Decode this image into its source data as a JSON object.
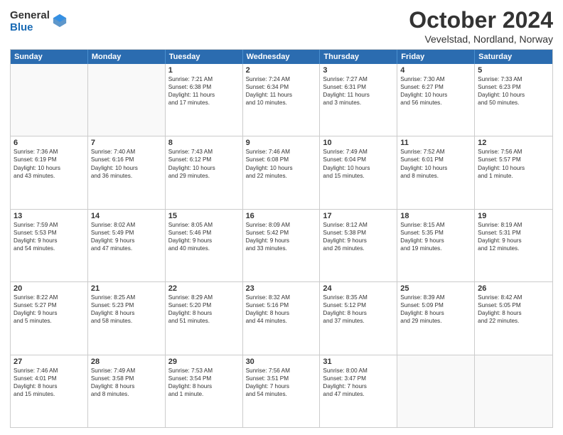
{
  "header": {
    "logo_general": "General",
    "logo_blue": "Blue",
    "title": "October 2024",
    "subtitle": "Vevelstad, Nordland, Norway"
  },
  "days_of_week": [
    "Sunday",
    "Monday",
    "Tuesday",
    "Wednesday",
    "Thursday",
    "Friday",
    "Saturday"
  ],
  "weeks": [
    [
      {
        "day": "",
        "info": ""
      },
      {
        "day": "",
        "info": ""
      },
      {
        "day": "1",
        "info": "Sunrise: 7:21 AM\nSunset: 6:38 PM\nDaylight: 11 hours\nand 17 minutes."
      },
      {
        "day": "2",
        "info": "Sunrise: 7:24 AM\nSunset: 6:34 PM\nDaylight: 11 hours\nand 10 minutes."
      },
      {
        "day": "3",
        "info": "Sunrise: 7:27 AM\nSunset: 6:31 PM\nDaylight: 11 hours\nand 3 minutes."
      },
      {
        "day": "4",
        "info": "Sunrise: 7:30 AM\nSunset: 6:27 PM\nDaylight: 10 hours\nand 56 minutes."
      },
      {
        "day": "5",
        "info": "Sunrise: 7:33 AM\nSunset: 6:23 PM\nDaylight: 10 hours\nand 50 minutes."
      }
    ],
    [
      {
        "day": "6",
        "info": "Sunrise: 7:36 AM\nSunset: 6:19 PM\nDaylight: 10 hours\nand 43 minutes."
      },
      {
        "day": "7",
        "info": "Sunrise: 7:40 AM\nSunset: 6:16 PM\nDaylight: 10 hours\nand 36 minutes."
      },
      {
        "day": "8",
        "info": "Sunrise: 7:43 AM\nSunset: 6:12 PM\nDaylight: 10 hours\nand 29 minutes."
      },
      {
        "day": "9",
        "info": "Sunrise: 7:46 AM\nSunset: 6:08 PM\nDaylight: 10 hours\nand 22 minutes."
      },
      {
        "day": "10",
        "info": "Sunrise: 7:49 AM\nSunset: 6:04 PM\nDaylight: 10 hours\nand 15 minutes."
      },
      {
        "day": "11",
        "info": "Sunrise: 7:52 AM\nSunset: 6:01 PM\nDaylight: 10 hours\nand 8 minutes."
      },
      {
        "day": "12",
        "info": "Sunrise: 7:56 AM\nSunset: 5:57 PM\nDaylight: 10 hours\nand 1 minute."
      }
    ],
    [
      {
        "day": "13",
        "info": "Sunrise: 7:59 AM\nSunset: 5:53 PM\nDaylight: 9 hours\nand 54 minutes."
      },
      {
        "day": "14",
        "info": "Sunrise: 8:02 AM\nSunset: 5:49 PM\nDaylight: 9 hours\nand 47 minutes."
      },
      {
        "day": "15",
        "info": "Sunrise: 8:05 AM\nSunset: 5:46 PM\nDaylight: 9 hours\nand 40 minutes."
      },
      {
        "day": "16",
        "info": "Sunrise: 8:09 AM\nSunset: 5:42 PM\nDaylight: 9 hours\nand 33 minutes."
      },
      {
        "day": "17",
        "info": "Sunrise: 8:12 AM\nSunset: 5:38 PM\nDaylight: 9 hours\nand 26 minutes."
      },
      {
        "day": "18",
        "info": "Sunrise: 8:15 AM\nSunset: 5:35 PM\nDaylight: 9 hours\nand 19 minutes."
      },
      {
        "day": "19",
        "info": "Sunrise: 8:19 AM\nSunset: 5:31 PM\nDaylight: 9 hours\nand 12 minutes."
      }
    ],
    [
      {
        "day": "20",
        "info": "Sunrise: 8:22 AM\nSunset: 5:27 PM\nDaylight: 9 hours\nand 5 minutes."
      },
      {
        "day": "21",
        "info": "Sunrise: 8:25 AM\nSunset: 5:23 PM\nDaylight: 8 hours\nand 58 minutes."
      },
      {
        "day": "22",
        "info": "Sunrise: 8:29 AM\nSunset: 5:20 PM\nDaylight: 8 hours\nand 51 minutes."
      },
      {
        "day": "23",
        "info": "Sunrise: 8:32 AM\nSunset: 5:16 PM\nDaylight: 8 hours\nand 44 minutes."
      },
      {
        "day": "24",
        "info": "Sunrise: 8:35 AM\nSunset: 5:12 PM\nDaylight: 8 hours\nand 37 minutes."
      },
      {
        "day": "25",
        "info": "Sunrise: 8:39 AM\nSunset: 5:09 PM\nDaylight: 8 hours\nand 29 minutes."
      },
      {
        "day": "26",
        "info": "Sunrise: 8:42 AM\nSunset: 5:05 PM\nDaylight: 8 hours\nand 22 minutes."
      }
    ],
    [
      {
        "day": "27",
        "info": "Sunrise: 7:46 AM\nSunset: 4:01 PM\nDaylight: 8 hours\nand 15 minutes."
      },
      {
        "day": "28",
        "info": "Sunrise: 7:49 AM\nSunset: 3:58 PM\nDaylight: 8 hours\nand 8 minutes."
      },
      {
        "day": "29",
        "info": "Sunrise: 7:53 AM\nSunset: 3:54 PM\nDaylight: 8 hours\nand 1 minute."
      },
      {
        "day": "30",
        "info": "Sunrise: 7:56 AM\nSunset: 3:51 PM\nDaylight: 7 hours\nand 54 minutes."
      },
      {
        "day": "31",
        "info": "Sunrise: 8:00 AM\nSunset: 3:47 PM\nDaylight: 7 hours\nand 47 minutes."
      },
      {
        "day": "",
        "info": ""
      },
      {
        "day": "",
        "info": ""
      }
    ]
  ]
}
